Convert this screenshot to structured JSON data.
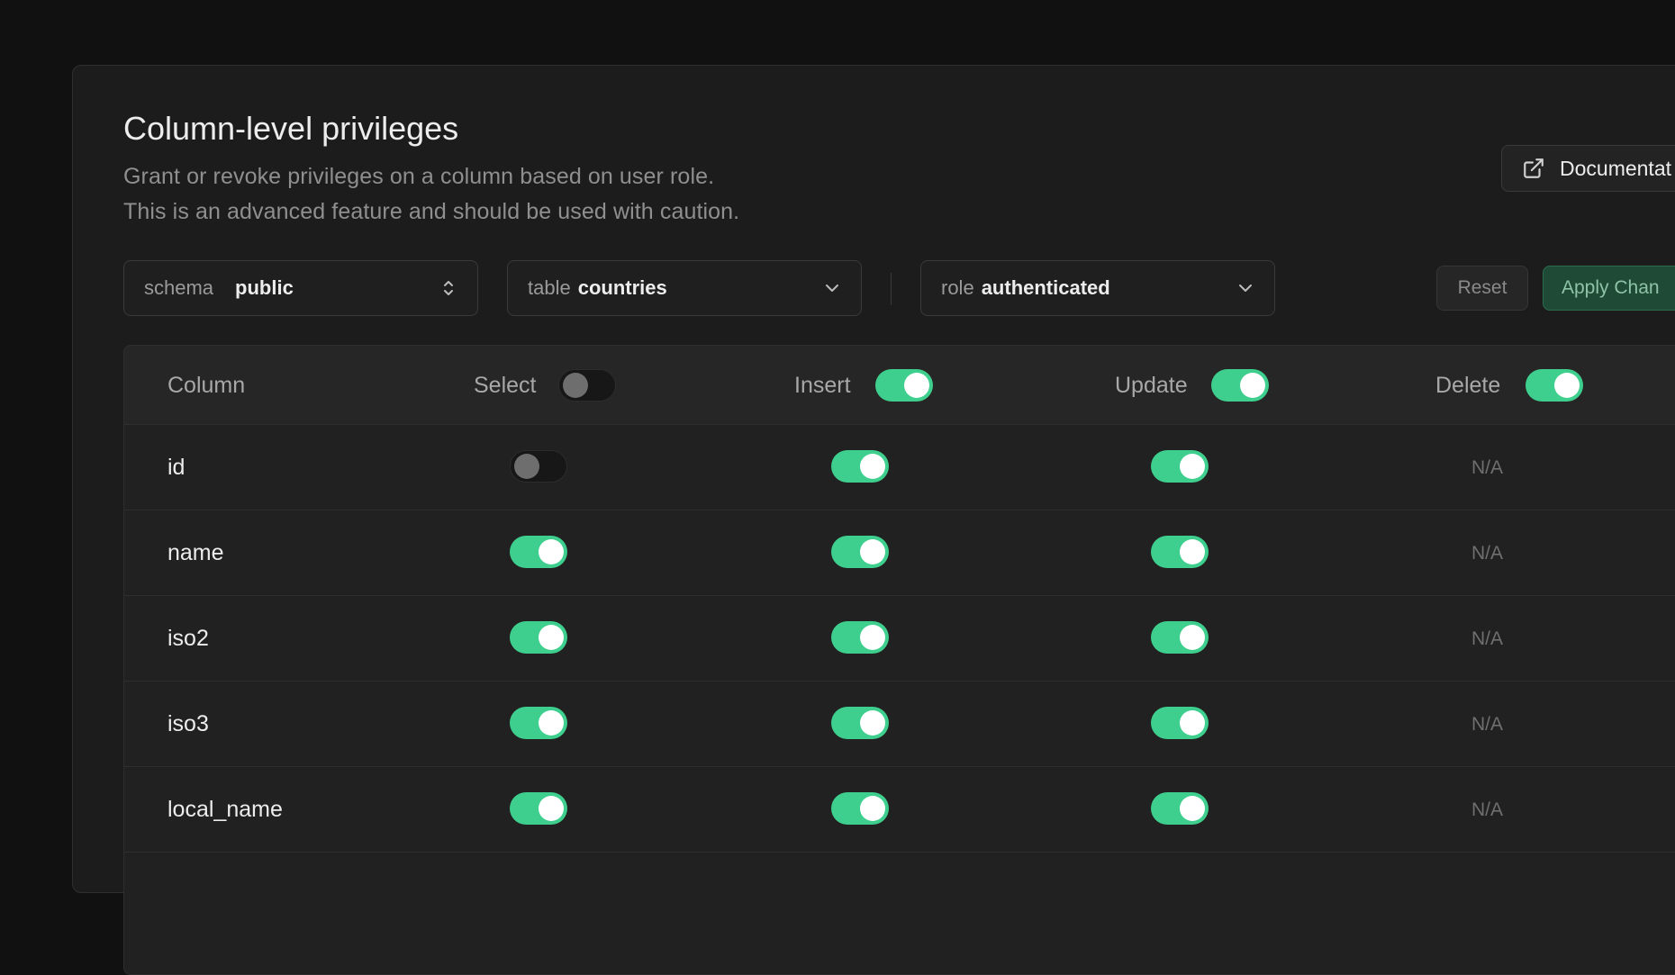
{
  "header": {
    "title": "Column-level privileges",
    "description_line1": "Grant or revoke privileges on a column based on user role.",
    "description_line2": "This is an advanced feature and should be used with caution.",
    "docs_button": "Documentat"
  },
  "filters": {
    "schema": {
      "label": "schema",
      "value": "public"
    },
    "table": {
      "label": "table",
      "value": "countries"
    },
    "role": {
      "label": "role",
      "value": "authenticated"
    }
  },
  "actions": {
    "reset": "Reset",
    "apply": "Apply Chan"
  },
  "colors": {
    "accent": "#3ecf8e",
    "background": "#111111",
    "panel": "#1c1c1c"
  },
  "table": {
    "headers": {
      "column": "Column",
      "select": "Select",
      "insert": "Insert",
      "update": "Update",
      "delete": "Delete"
    },
    "header_toggles": {
      "select": false,
      "insert": true,
      "update": true,
      "delete": true
    },
    "rows": [
      {
        "name": "id",
        "select": false,
        "insert": true,
        "update": true,
        "delete": "N/A"
      },
      {
        "name": "name",
        "select": true,
        "insert": true,
        "update": true,
        "delete": "N/A"
      },
      {
        "name": "iso2",
        "select": true,
        "insert": true,
        "update": true,
        "delete": "N/A"
      },
      {
        "name": "iso3",
        "select": true,
        "insert": true,
        "update": true,
        "delete": "N/A"
      },
      {
        "name": "local_name",
        "select": true,
        "insert": true,
        "update": true,
        "delete": "N/A"
      }
    ]
  }
}
